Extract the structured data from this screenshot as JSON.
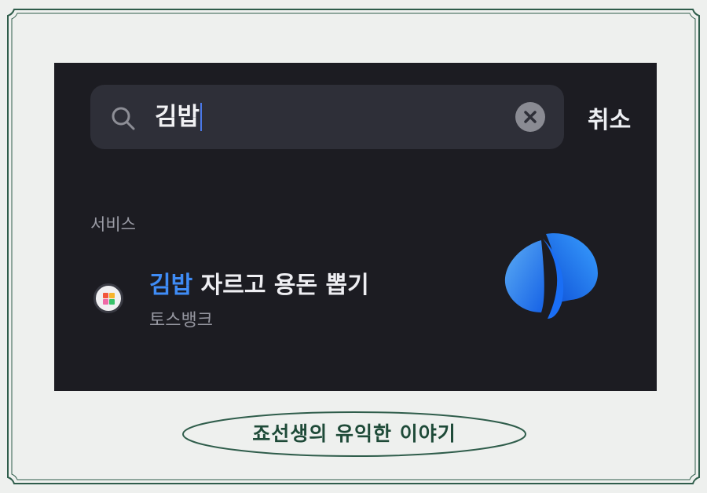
{
  "search": {
    "query": "김밥",
    "cancel_label": "취소"
  },
  "section": {
    "label": "서비스"
  },
  "result": {
    "title_highlight": "김밥",
    "title_rest": " 자르고 용돈 뽑기",
    "subtitle": "토스뱅크"
  },
  "caption": {
    "text": "죠선생의 유익한 이야기"
  },
  "colors": {
    "frame_border": "#2f5d4b",
    "background": "#1c1c22",
    "search_box": "#2e2f38",
    "highlight": "#3f8cf6",
    "caption_text": "#1e4a38"
  },
  "icons": [
    "search-icon",
    "clear-icon",
    "app-icon",
    "toss-logo-thumbnail"
  ]
}
